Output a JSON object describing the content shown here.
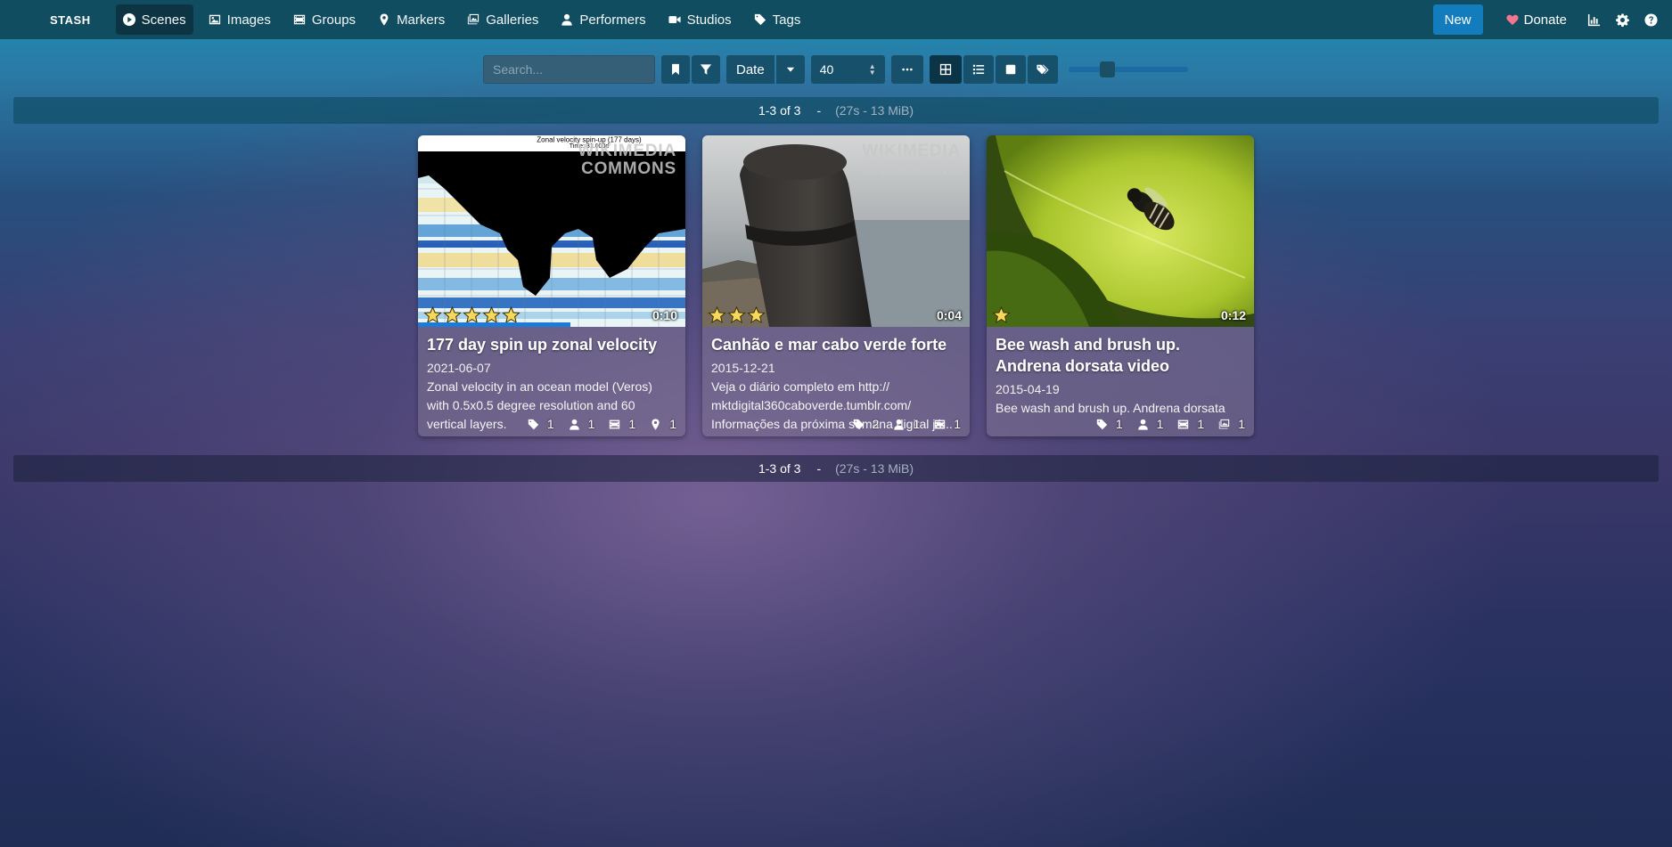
{
  "navbar": {
    "brand": "STASH",
    "items": [
      {
        "label": "Scenes",
        "icon": "play-circle-icon",
        "active": true
      },
      {
        "label": "Images",
        "icon": "image-icon"
      },
      {
        "label": "Groups",
        "icon": "film-icon"
      },
      {
        "label": "Markers",
        "icon": "map-marker-icon"
      },
      {
        "label": "Galleries",
        "icon": "images-icon"
      },
      {
        "label": "Performers",
        "icon": "user-icon"
      },
      {
        "label": "Studios",
        "icon": "video-icon"
      },
      {
        "label": "Tags",
        "icon": "tag-icon"
      }
    ],
    "new_label": "New",
    "donate_label": "Donate"
  },
  "toolbar": {
    "search_placeholder": "Search...",
    "sort_by": "Date",
    "per_page": "40",
    "zoom_level": 0.3
  },
  "pagination": {
    "count": "1-3 of 3",
    "separator": "-",
    "stats": "(27s - 13 MiB)"
  },
  "scenes": [
    {
      "title": "177 day spin up zonal velocity",
      "date": "2021-06-07",
      "description": "Zonal velocity in an ocean model (Veros) with 0.5x0.5 degree resolution and 60 vertical layers.",
      "duration": "0:10",
      "rating_stars": 5,
      "watermark_line1": "WIKIMEDIA",
      "watermark_line2": "COMMONS",
      "thumb_title_line1": "Zonal velocity spin-up (177 days)",
      "thumb_title_line2": "Time: 31.000d",
      "progress": 0.57,
      "counts": {
        "tags": "1",
        "performers": "1",
        "groups": "1",
        "markers": "1"
      }
    },
    {
      "title": "Canhão e mar cabo verde forte",
      "date": "2015-12-21",
      "description": "Veja o diário completo em http:// mktdigital360caboverde.tumblr.com/ Informações da próxima semana digital já...",
      "duration": "0:04",
      "rating_stars": 3,
      "watermark_line1": "WIKIMEDIA",
      "watermark_line2": "COMMONS",
      "counts": {
        "tags": "2",
        "performers": "1",
        "groups": "1"
      }
    },
    {
      "title": "Bee wash and brush up. Andrena dorsata video",
      "date": "2015-04-19",
      "description": "Bee wash and brush up. Andrena dorsata",
      "duration": "0:12",
      "rating_stars": 1,
      "counts": {
        "tags": "1",
        "performers": "1",
        "groups": "1",
        "galleries": "1"
      }
    }
  ]
}
